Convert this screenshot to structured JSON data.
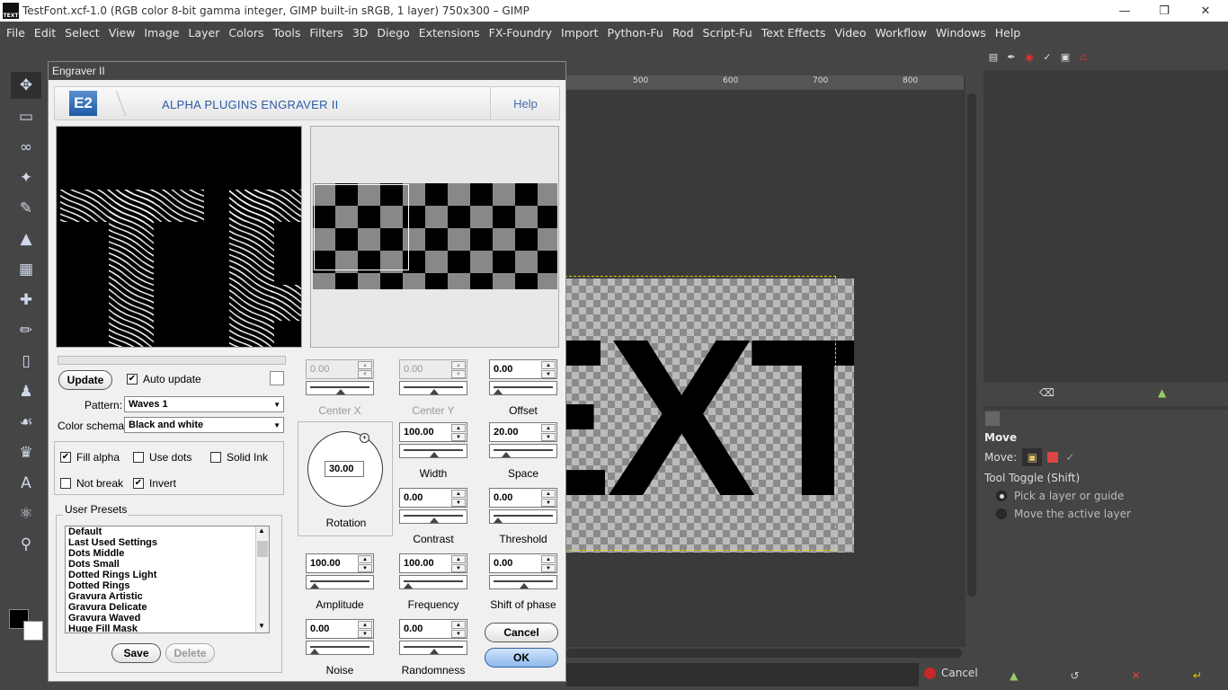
{
  "window": {
    "title": "TestFont.xcf-1.0 (RGB color 8-bit gamma integer, GIMP built-in sRGB, 1 layer) 750x300 – GIMP",
    "app_icon_text": "TEXT"
  },
  "menu": [
    "File",
    "Edit",
    "Select",
    "View",
    "Image",
    "Layer",
    "Colors",
    "Tools",
    "Filters",
    "3D",
    "Diego",
    "Extensions",
    "FX-Foundry",
    "Import",
    "Python-Fu",
    "Rod",
    "Script-Fu",
    "Text Effects",
    "Video",
    "Workflow",
    "Windows",
    "Help"
  ],
  "ruler": [
    "500",
    "600",
    "700",
    "800"
  ],
  "canvas": {
    "image_text": "EXT"
  },
  "status": {
    "cancel_label": "Cancel"
  },
  "tool_options": {
    "header": "Move",
    "move_label": "Move:",
    "toggle_label": "Tool Toggle  (Shift)",
    "options": [
      {
        "label": "Pick a layer or guide",
        "selected": true
      },
      {
        "label": "Move the active layer",
        "selected": false
      }
    ]
  },
  "dialog": {
    "title": "Engraver II",
    "logo": "E2",
    "plugin_name": "ALPHA PLUGINS ENGRAVER II",
    "help": "Help",
    "update_button": "Update",
    "auto_update": "Auto update",
    "pattern_label": "Pattern:",
    "pattern_value": "Waves 1",
    "color_schema_label": "Color schema:",
    "color_schema_value": "Black and white",
    "checkboxes": {
      "fill_alpha": {
        "label": "Fill alpha",
        "checked": true
      },
      "use_dots": {
        "label": "Use dots",
        "checked": false
      },
      "solid_ink": {
        "label": "Solid Ink",
        "checked": false
      },
      "not_break": {
        "label": "Not break",
        "checked": false
      },
      "invert": {
        "label": "Invert",
        "checked": true
      }
    },
    "user_presets_label": "User Presets",
    "presets": [
      "Default",
      "Last Used Settings",
      "Dots Middle",
      "Dots Small",
      "Dotted Rings Light",
      "Dotted Rings",
      "Gravura Artistic",
      "Gravura Delicate",
      "Gravura Waved",
      "Huge Fill Mask"
    ],
    "save_button": "Save",
    "delete_button": "Delete",
    "params": {
      "center_x": {
        "label": "Center X",
        "value": "0.00",
        "level": 0.5
      },
      "center_y": {
        "label": "Center Y",
        "value": "0.00",
        "level": 0.5
      },
      "offset": {
        "label": "Offset",
        "value": "0.00",
        "level": 0.0
      },
      "width": {
        "label": "Width",
        "value": "100.00",
        "level": 0.5
      },
      "space": {
        "label": "Space",
        "value": "20.00",
        "level": 0.15
      },
      "contrast": {
        "label": "Contrast",
        "value": "0.00",
        "level": 0.5
      },
      "threshold": {
        "label": "Threshold",
        "value": "0.00",
        "level": 0.0
      },
      "amplitude": {
        "label": "Amplitude",
        "value": "100.00",
        "level": 0.0
      },
      "frequency": {
        "label": "Frequency",
        "value": "100.00",
        "level": 0.0
      },
      "shift_of_phase": {
        "label": "Shift of phase",
        "value": "0.00",
        "level": 0.5
      },
      "noise": {
        "label": "Noise",
        "value": "0.00",
        "level": 0.0
      },
      "randomness": {
        "label": "Randomness",
        "value": "0.00",
        "level": 0.5
      }
    },
    "rotation": {
      "label": "Rotation",
      "value": "30.00"
    },
    "cancel_button": "Cancel",
    "ok_button": "OK"
  }
}
